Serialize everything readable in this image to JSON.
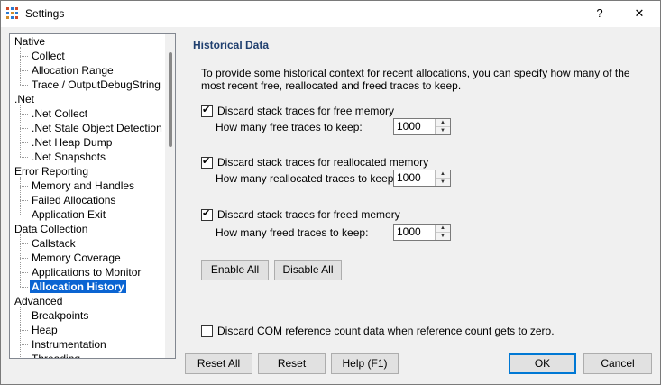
{
  "window": {
    "title": "Settings",
    "help_glyph": "?",
    "close_glyph": "✕"
  },
  "tree": {
    "groups": [
      {
        "label": "Native",
        "items": [
          "Collect",
          "Allocation Range",
          "Trace / OutputDebugString"
        ]
      },
      {
        "label": ".Net",
        "items": [
          ".Net Collect",
          ".Net Stale Object Detection",
          ".Net Heap Dump",
          ".Net Snapshots"
        ]
      },
      {
        "label": "Error Reporting",
        "items": [
          "Memory and Handles",
          "Failed Allocations",
          "Application Exit"
        ]
      },
      {
        "label": "Data Collection",
        "items": [
          "Callstack",
          "Memory Coverage",
          "Applications to Monitor",
          "Allocation History"
        ]
      },
      {
        "label": "Advanced",
        "items": [
          "Breakpoints",
          "Heap",
          "Instrumentation",
          "Threading"
        ]
      }
    ],
    "selected": "Allocation History"
  },
  "panel": {
    "title": "Historical Data",
    "description": "To provide some historical context for recent allocations, you can specify how many of the most recent free, reallocated and freed traces to keep.",
    "free": {
      "checkbox_label": "Discard stack traces for free memory",
      "checked": true,
      "count_label": "How many free traces to keep:",
      "value": "1000"
    },
    "realloc": {
      "checkbox_label": "Discard stack traces for reallocated memory",
      "checked": true,
      "count_label": "How many reallocated traces to keep:",
      "value": "1000"
    },
    "freed": {
      "checkbox_label": "Discard stack traces for freed memory",
      "checked": true,
      "count_label": "How many freed traces to keep:",
      "value": "1000"
    },
    "enable_all": "Enable All",
    "disable_all": "Disable All",
    "com": {
      "checkbox_label": "Discard COM reference count data when reference count gets to zero.",
      "checked": false
    }
  },
  "footer": {
    "reset_all": "Reset All",
    "reset": "Reset",
    "help": "Help (F1)",
    "ok": "OK",
    "cancel": "Cancel"
  }
}
